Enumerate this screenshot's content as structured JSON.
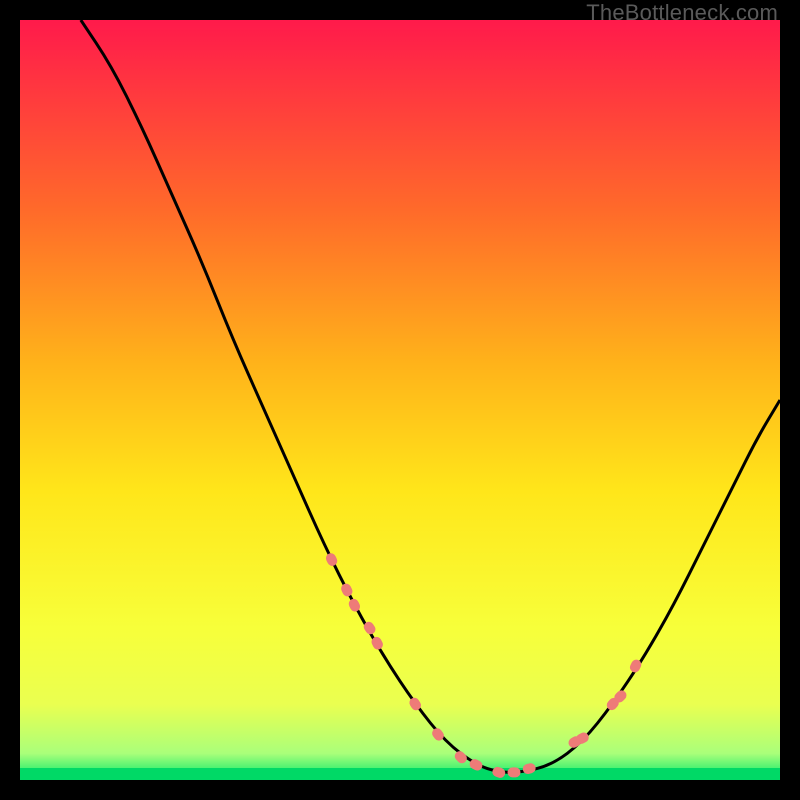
{
  "watermark": "TheBottleneck.com",
  "chart_data": {
    "type": "line",
    "title": "",
    "xlabel": "",
    "ylabel": "",
    "xlim": [
      0,
      100
    ],
    "ylim": [
      0,
      100
    ],
    "grid": false,
    "legend": false,
    "gradient_stops": [
      {
        "offset": 0.0,
        "color": "#ff1a4b"
      },
      {
        "offset": 0.25,
        "color": "#ff6a2a"
      },
      {
        "offset": 0.45,
        "color": "#ffb21a"
      },
      {
        "offset": 0.62,
        "color": "#ffe61a"
      },
      {
        "offset": 0.8,
        "color": "#f7ff3a"
      },
      {
        "offset": 0.9,
        "color": "#eaff50"
      },
      {
        "offset": 0.965,
        "color": "#aaff7a"
      },
      {
        "offset": 1.0,
        "color": "#00e86b"
      }
    ],
    "series": [
      {
        "name": "bottleneck-curve",
        "color": "#000000",
        "x": [
          8,
          12,
          16,
          20,
          24,
          28,
          32,
          36,
          40,
          44,
          48,
          52,
          56,
          60,
          63,
          66,
          70,
          74,
          78,
          82,
          86,
          90,
          94,
          97,
          100
        ],
        "values": [
          100,
          94,
          86,
          77,
          68,
          58,
          49,
          40,
          31,
          23,
          16,
          10,
          5,
          2,
          1,
          1,
          2,
          5,
          10,
          16,
          23,
          31,
          39,
          45,
          50
        ]
      },
      {
        "name": "curve-highlight-dots",
        "color": "#ee7b78",
        "x": [
          41,
          43,
          44,
          46,
          47,
          52,
          55,
          58,
          60,
          63,
          65,
          67,
          73,
          74,
          78,
          79,
          81
        ],
        "values": [
          29,
          25,
          23,
          20,
          18,
          10,
          6,
          3,
          2,
          1,
          1,
          1.5,
          5,
          5.5,
          10,
          11,
          15
        ]
      }
    ]
  }
}
